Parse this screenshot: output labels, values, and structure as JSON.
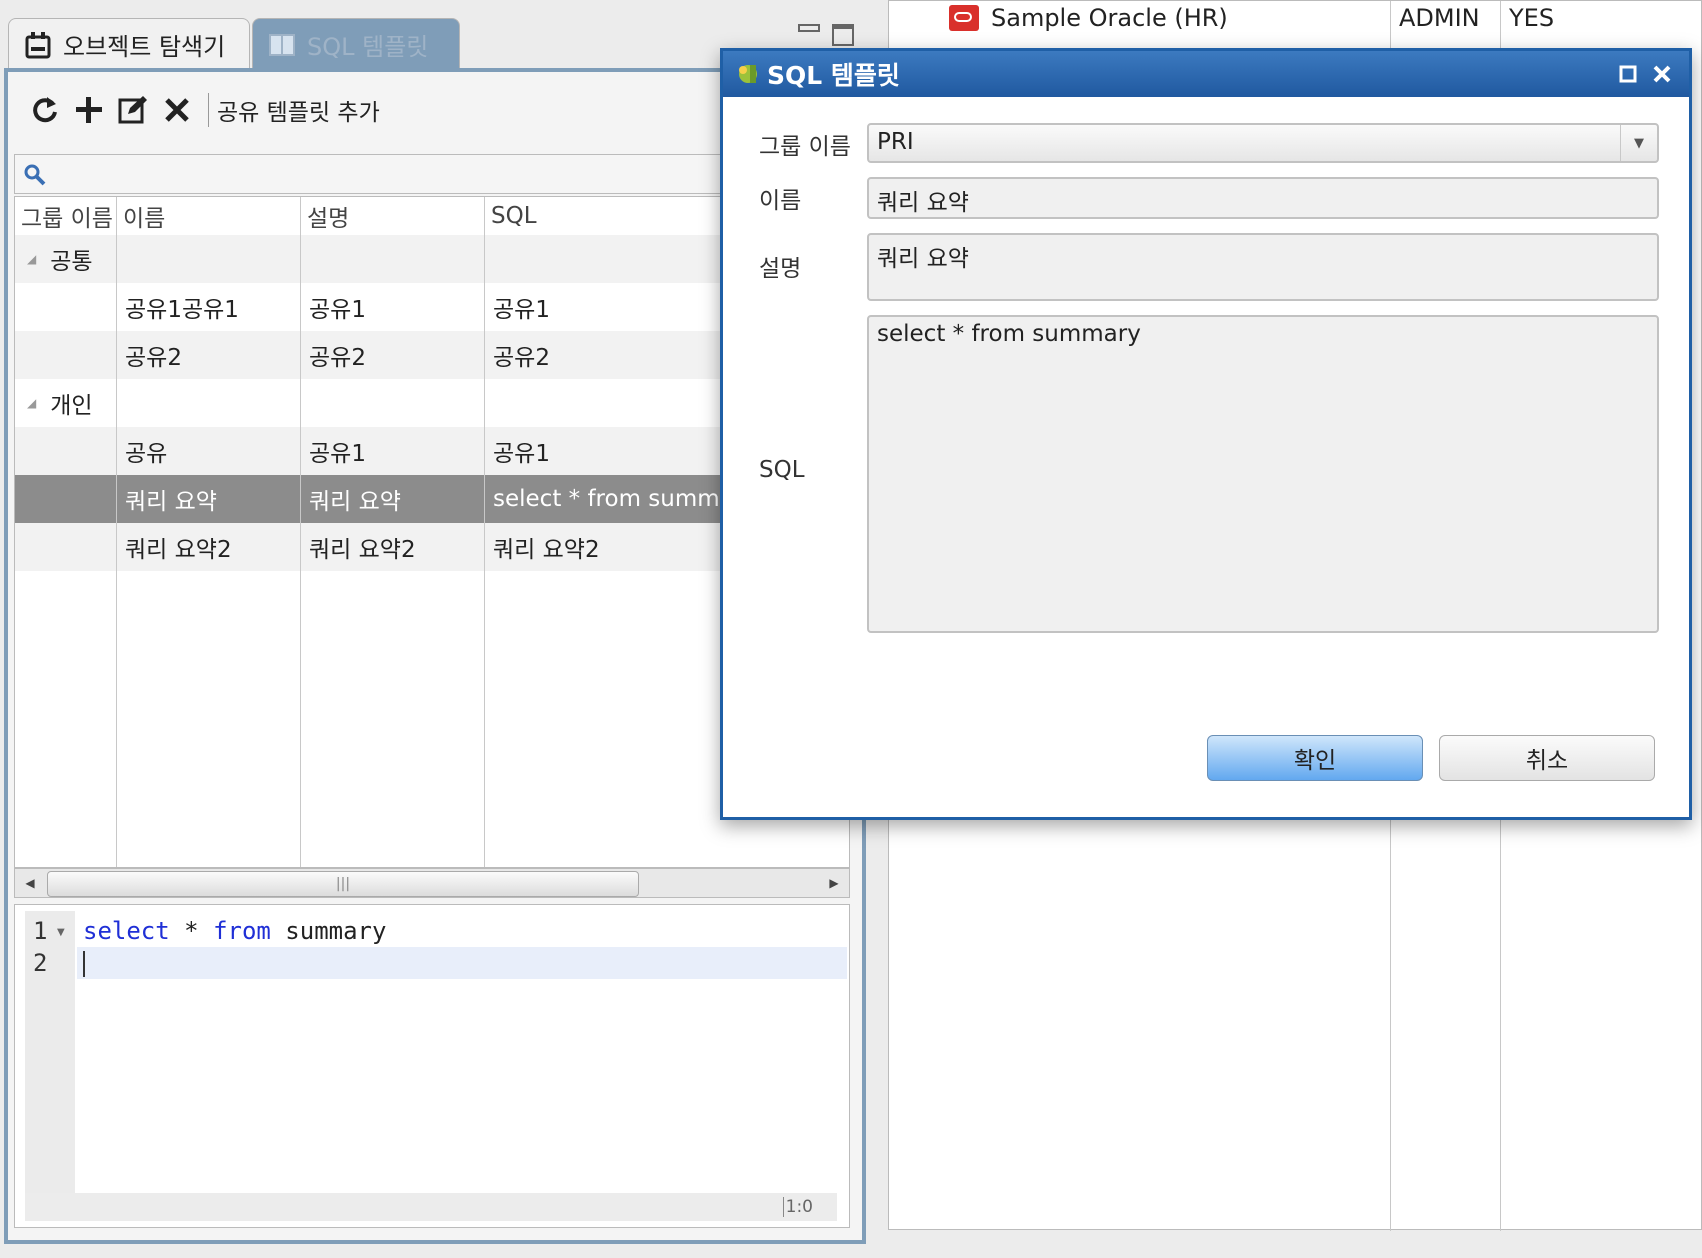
{
  "tabs": {
    "object_explorer": "오브젝트 탐색기",
    "sql_template": "SQL 템플릿"
  },
  "toolbar": {
    "refresh_icon": "refresh-icon",
    "add_icon": "plus-icon",
    "edit_icon": "edit-icon",
    "delete_icon": "close-icon",
    "add_shared_label": "공유 템플릿 추가"
  },
  "search": {
    "placeholder": ""
  },
  "grid": {
    "columns": [
      "그룹 이름",
      "이름",
      "설명",
      "SQL"
    ],
    "rows": [
      {
        "group": "공통",
        "name": "",
        "desc": "",
        "sql": ""
      },
      {
        "group": "",
        "name": "공유1공유1",
        "desc": "공유1",
        "sql": "공유1"
      },
      {
        "group": "",
        "name": "공유2",
        "desc": "공유2",
        "sql": "공유2"
      },
      {
        "group": "개인",
        "name": "",
        "desc": "",
        "sql": ""
      },
      {
        "group": "",
        "name": "공유",
        "desc": "공유1",
        "sql": "공유1"
      },
      {
        "group": "",
        "name": "쿼리 요약",
        "desc": "쿼리 요약",
        "sql": "select * from summary"
      },
      {
        "group": "",
        "name": "쿼리 요약2",
        "desc": "쿼리 요약2",
        "sql": "쿼리 요약2"
      }
    ],
    "selected_row": 5
  },
  "editor": {
    "line1_number": "1",
    "line2_number": "2",
    "code_kw1": "select",
    "code_op": " * ",
    "code_kw2": "from",
    "code_ident": " summary",
    "cursor_position": "1:0"
  },
  "background_table": {
    "connection_name": "Sample Oracle (HR)",
    "user": "ADMIN",
    "flag": "YES"
  },
  "dialog": {
    "title": "SQL 템플릿",
    "group_label": "그룹 이름",
    "group_value": "PRI",
    "name_label": "이름",
    "name_value": "쿼리 요약",
    "desc_label": "설명",
    "desc_value": "쿼리 요약",
    "sql_label": "SQL",
    "sql_value": "select * from summary",
    "ok_label": "확인",
    "cancel_label": "취소"
  },
  "colors": {
    "dialog_title_bg": "#2a64aa",
    "tab_active_bg": "#7f9db8",
    "selected_row_bg": "#8c8c8c",
    "keyword": "#1f2fd6",
    "ok_button": "#62a8ef"
  }
}
